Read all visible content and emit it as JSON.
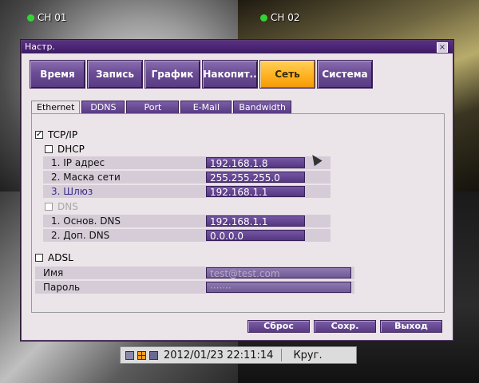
{
  "cameras": [
    {
      "label": "CH 01"
    },
    {
      "label": "CH 02"
    }
  ],
  "dialog": {
    "title": "Настр.",
    "close": "×"
  },
  "menu_tabs": [
    "Время",
    "Запись",
    "График",
    "Накопит..",
    "Сеть",
    "Система"
  ],
  "active_menu_tab": "Сеть",
  "sub_tabs": [
    "Ethernet",
    "DDNS",
    "Port",
    "E-Mail",
    "Bandwidth"
  ],
  "active_sub_tab": "Ethernet",
  "network": {
    "tcpip": {
      "label": "TCP/IP",
      "checked": true,
      "check_mark": "✓"
    },
    "dhcp": {
      "label": "DHCP",
      "checked": false
    },
    "ip": {
      "label": "1. IP адрес",
      "value": "192.168.1.8"
    },
    "mask": {
      "label": "2. Маска сети",
      "value": "255.255.255.0"
    },
    "gateway": {
      "label": "3. Шлюз",
      "value": "192.168.1.1"
    },
    "dns": {
      "label": "DNS",
      "checked": false,
      "disabled": true
    },
    "dns_primary": {
      "label": "1. Основ. DNS",
      "value": "192.168.1.1"
    },
    "dns_secondary": {
      "label": "2. Доп. DNS",
      "value": "0.0.0.0"
    },
    "adsl": {
      "label": "ADSL",
      "checked": false
    },
    "name": {
      "label": "Имя",
      "value": "test@test.com"
    },
    "password": {
      "label": "Пароль",
      "value": "·······"
    }
  },
  "buttons": {
    "reset": "Сброс",
    "save": "Сохр.",
    "exit": "Выход"
  },
  "statusbar": {
    "datetime": "2012/01/23 22:11:14",
    "mode": "Круг."
  },
  "colors": {
    "accent_purple": "#6b4c96",
    "active_tab": "#ffb21f",
    "channel_online": "#35d435"
  }
}
